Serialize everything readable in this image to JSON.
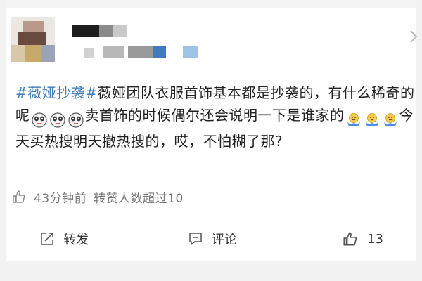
{
  "post": {
    "hashtag": "#薇娅抄袭#",
    "text_1": "薇娅团队衣服首饰基本都是抄袭的，有什么稀奇的呢",
    "text_2": "卖首饰的时候偶尔还会说明一下是谁家的",
    "text_3": "今天买热搜明天撤热搜的，哎，不怕糊了那?"
  },
  "meta": {
    "time": "43分钟前",
    "reposts_note": "转赞人数超过10"
  },
  "actions": {
    "repost_label": "转发",
    "comment_label": "评论",
    "like_count": "13"
  },
  "icons": {
    "like": "thumbs-up-icon",
    "repost": "share-arrow-icon",
    "comment": "comment-bubble-icon",
    "emoji_a": "panda-face-emoji",
    "emoji_b": "shrug-emoji"
  },
  "colors": {
    "hashtag": "#3d7dbb",
    "meta_text": "#777777",
    "body_text": "#222222"
  }
}
